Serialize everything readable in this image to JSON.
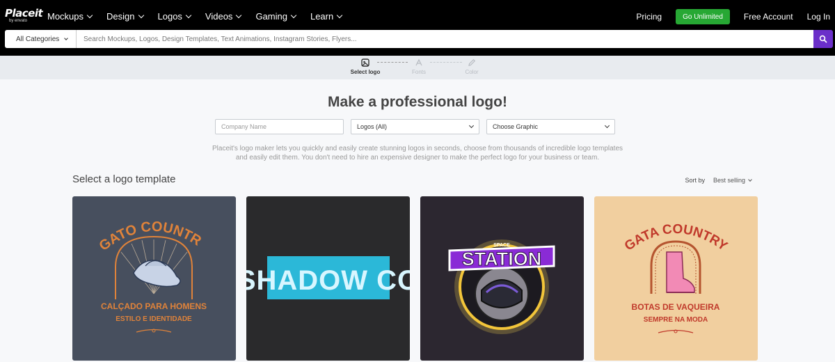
{
  "brand": {
    "name": "Placeit",
    "sub": "by envato"
  },
  "nav": {
    "items": [
      {
        "label": "Mockups"
      },
      {
        "label": "Design"
      },
      {
        "label": "Logos"
      },
      {
        "label": "Videos"
      },
      {
        "label": "Gaming"
      },
      {
        "label": "Learn"
      }
    ],
    "pricing": "Pricing",
    "go_unlimited": "Go Unlimited",
    "free_account": "Free Account",
    "login": "Log In"
  },
  "search": {
    "category": "All Categories",
    "placeholder": "Search Mockups, Logos, Design Templates, Text Animations, Instagram Stories, Flyers..."
  },
  "steps": [
    {
      "label": "Select logo",
      "icon": "select-logo-icon",
      "active": true
    },
    {
      "label": "Fonts",
      "icon": "fonts-icon",
      "active": false
    },
    {
      "label": "Color",
      "icon": "pencil-icon",
      "active": false
    }
  ],
  "main": {
    "headline": "Make a professional logo!",
    "company_placeholder": "Company Name",
    "logos_select": "Logos (All)",
    "graphic_select": "Choose Graphic",
    "description": "Placeit's logo maker lets you quickly and easily create stunning logos in seconds, choose from thousands of incredible logo templates and easily edit them. You don't need to hire an expensive designer to make the perfect logo for your business or team.",
    "section_title": "Select a logo template",
    "sort_label": "Sort by",
    "sort_value": "Best selling"
  },
  "cards": [
    {
      "bg": "#474f5e",
      "title": "GATO COUNTRY",
      "line1": "CALÇADO PARA HOMENS",
      "line2": "ESTILO E IDENTIDADE"
    },
    {
      "bg": "#2a2a2c",
      "title": "SHADOW CO"
    },
    {
      "bg": "#2c2730",
      "small": "SPACE",
      "title": "STATION"
    },
    {
      "bg": "#f1cf9f",
      "title": "GATA COUNTRY",
      "line1": "BOTAS DE VAQUEIRA",
      "line2": "SEMPRE NA MODA"
    }
  ],
  "colors": {
    "accent": "#6b2fc9",
    "unlimited": "#27a834"
  }
}
